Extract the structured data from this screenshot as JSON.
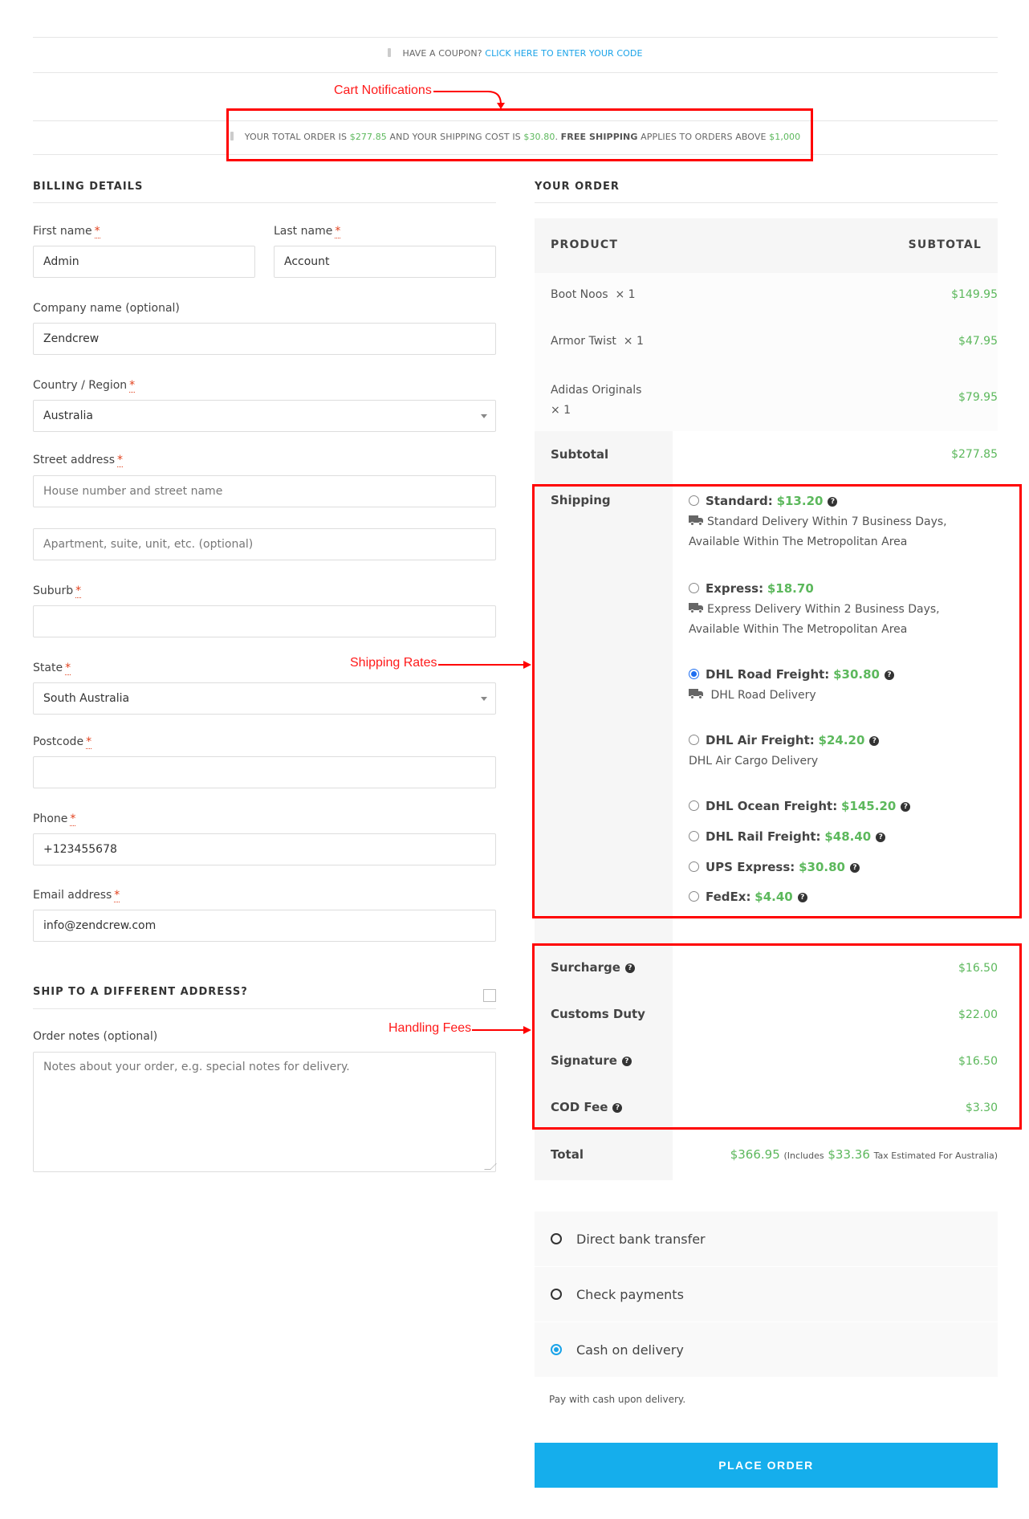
{
  "coupon_notice": {
    "prefix": "HAVE A COUPON?",
    "link": "CLICK HERE TO ENTER YOUR CODE",
    "icon": "info-icon"
  },
  "cart_notice": {
    "part1": "YOUR TOTAL ORDER IS",
    "order_total": "$277.85",
    "part2": "AND YOUR SHIPPING COST IS",
    "shipping_cost": "$30.80",
    "part3": ".",
    "free_shipping": "FREE SHIPPING",
    "part4": "APPLIES TO ORDERS ABOVE",
    "threshold": "$1,000",
    "icon": "info-icon"
  },
  "annotations": {
    "cart_notifications": "Cart Notifications",
    "shipping_rates": "Shipping Rates",
    "handling_fees": "Handling Fees"
  },
  "billing": {
    "title": "BILLING DETAILS",
    "required_mark": "*",
    "fields": {
      "first_name": {
        "label": "First name",
        "value": "Admin"
      },
      "last_name": {
        "label": "Last name",
        "value": "Account"
      },
      "company": {
        "label": "Company name (optional)",
        "value": "Zendcrew"
      },
      "country": {
        "label": "Country / Region",
        "value": "Australia"
      },
      "street": {
        "label": "Street address",
        "placeholder": "House number and street name",
        "value": ""
      },
      "apartment": {
        "placeholder": "Apartment, suite, unit, etc. (optional)",
        "value": ""
      },
      "suburb": {
        "label": "Suburb",
        "value": ""
      },
      "state": {
        "label": "State",
        "value": "South Australia"
      },
      "postcode": {
        "label": "Postcode",
        "value": ""
      },
      "phone": {
        "label": "Phone",
        "value": "+123455678"
      },
      "email": {
        "label": "Email address",
        "value": "info@zendcrew.com"
      }
    },
    "ship_different": {
      "label": "SHIP TO A DIFFERENT ADDRESS?",
      "checked": false
    },
    "order_notes": {
      "label": "Order notes (optional)",
      "placeholder": "Notes about your order, e.g. special notes for delivery."
    }
  },
  "order": {
    "title": "YOUR ORDER",
    "headers": {
      "product": "PRODUCT",
      "subtotal": "SUBTOTAL"
    },
    "items": [
      {
        "name": "Boot Noos",
        "qty": "× 1",
        "total": "$149.95"
      },
      {
        "name": "Armor Twist",
        "qty": "× 1",
        "total": "$47.95"
      },
      {
        "name": "Adidas Originals",
        "qty": "× 1",
        "total": "$79.95"
      }
    ],
    "subtotal": {
      "label": "Subtotal",
      "value": "$277.85"
    },
    "shipping": {
      "label": "Shipping",
      "options": [
        {
          "name": "Standard:",
          "price": "$13.20",
          "help": true,
          "selected": false,
          "desc": "Standard Delivery Within 7 Business Days, Available Within The Metropolitan Area",
          "truck": true
        },
        {
          "name": "Express:",
          "price": "$18.70",
          "help": false,
          "selected": false,
          "desc": "Express Delivery Within 2 Business Days, Available Within The Metropolitan Area",
          "truck": true
        },
        {
          "name": "DHL Road Freight:",
          "price": "$30.80",
          "help": true,
          "selected": true,
          "desc": "DHL Road Delivery",
          "truck": true
        },
        {
          "name": "DHL Air Freight:",
          "price": "$24.20",
          "help": true,
          "selected": false,
          "desc": "DHL Air Cargo Delivery",
          "truck": false
        },
        {
          "name": "DHL Ocean Freight:",
          "price": "$145.20",
          "help": true,
          "selected": false
        },
        {
          "name": "DHL Rail Freight:",
          "price": "$48.40",
          "help": true,
          "selected": false
        },
        {
          "name": "UPS Express:",
          "price": "$30.80",
          "help": true,
          "selected": false
        },
        {
          "name": "FedEx:",
          "price": "$4.40",
          "help": true,
          "selected": false
        }
      ]
    },
    "fees": [
      {
        "label": "Surcharge",
        "value": "$16.50",
        "help": true
      },
      {
        "label": "Customs Duty",
        "value": "$22.00",
        "help": false
      },
      {
        "label": "Signature",
        "value": "$16.50",
        "help": true
      },
      {
        "label": "COD Fee",
        "value": "$3.30",
        "help": true
      }
    ],
    "total": {
      "label": "Total",
      "value": "$366.95",
      "includes_prefix": "(Includes",
      "tax": "$33.36",
      "includes_suffix": "Tax Estimated For Australia)"
    }
  },
  "payment": {
    "methods": [
      {
        "label": "Direct bank transfer",
        "selected": false
      },
      {
        "label": "Check payments",
        "selected": false
      },
      {
        "label": "Cash on delivery",
        "selected": true
      }
    ],
    "description": "Pay with cash upon delivery.",
    "place_order": "PLACE ORDER"
  },
  "colors": {
    "price_green": "#5cb85c",
    "link_blue": "#1aa3e8",
    "button_blue": "#15aeec",
    "annotation_red": "#ff0000"
  }
}
